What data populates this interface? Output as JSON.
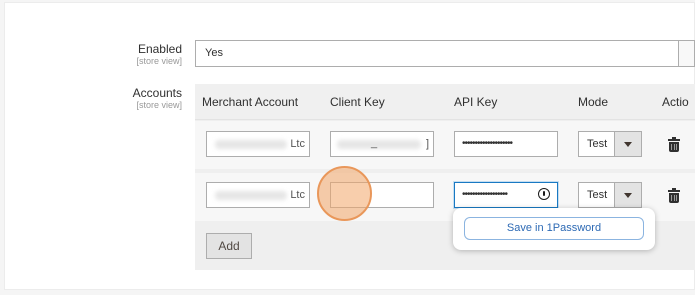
{
  "enabled": {
    "label": "Enabled",
    "scope": "[store view]",
    "value": "Yes"
  },
  "accounts": {
    "label": "Accounts",
    "scope": "[store view]",
    "columns": [
      "Merchant Account",
      "Client Key",
      "API Key",
      "Mode",
      "Actio"
    ],
    "rows": [
      {
        "merchant_suffix": "Ltc",
        "client_suffix": "_",
        "client_end": "]",
        "api_key": "••••••••••••••••••••",
        "mode": "Test"
      },
      {
        "merchant_suffix": "Ltc",
        "client_suffix": "",
        "client_end": "",
        "api_key": "••••••••••••••••••",
        "mode": "Test"
      }
    ],
    "add_label": "Add"
  },
  "password_popup": {
    "save_label": "Save in 1Password",
    "icon": "1password-icon"
  },
  "colors": {
    "focus_border": "#1979c3",
    "popup_text": "#2c69b4",
    "cursor_highlight": "#f3a668"
  }
}
